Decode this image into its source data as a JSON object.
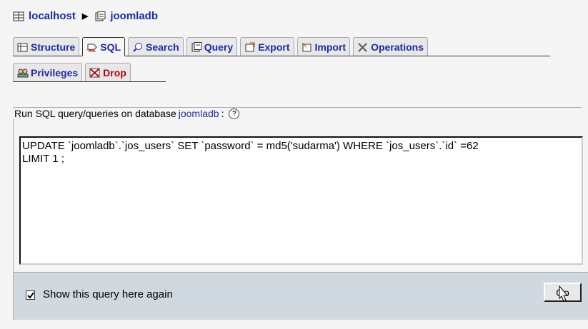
{
  "breadcrumb": {
    "server": "localhost",
    "database": "joomladb"
  },
  "tabs_row1": [
    {
      "label": "Structure",
      "icon": "structure-icon"
    },
    {
      "label": "SQL",
      "icon": "sql-icon"
    },
    {
      "label": "Search",
      "icon": "search-icon"
    },
    {
      "label": "Query",
      "icon": "query-icon"
    },
    {
      "label": "Export",
      "icon": "export-icon"
    },
    {
      "label": "Import",
      "icon": "import-icon"
    },
    {
      "label": "Operations",
      "icon": "operations-icon"
    }
  ],
  "tabs_row2": [
    {
      "label": "Privileges",
      "icon": "privileges-icon"
    },
    {
      "label": "Drop",
      "icon": "drop-icon"
    }
  ],
  "query_panel": {
    "legend_prefix": "Run SQL query/queries on database",
    "database": "joomladb",
    "legend_suffix": ":",
    "query": "UPDATE `joomladb`.`jos_users` SET `password` = md5('sudarma') WHERE `jos_users`.`id` =62\nLIMIT 1 ;"
  },
  "footer": {
    "show_again_label": "Show this query here again",
    "show_again_checked": true,
    "go_label": "Go"
  },
  "colors": {
    "link": "#1d2aa8",
    "drop": "#c00000",
    "footer_bg": "#cfd9df"
  }
}
